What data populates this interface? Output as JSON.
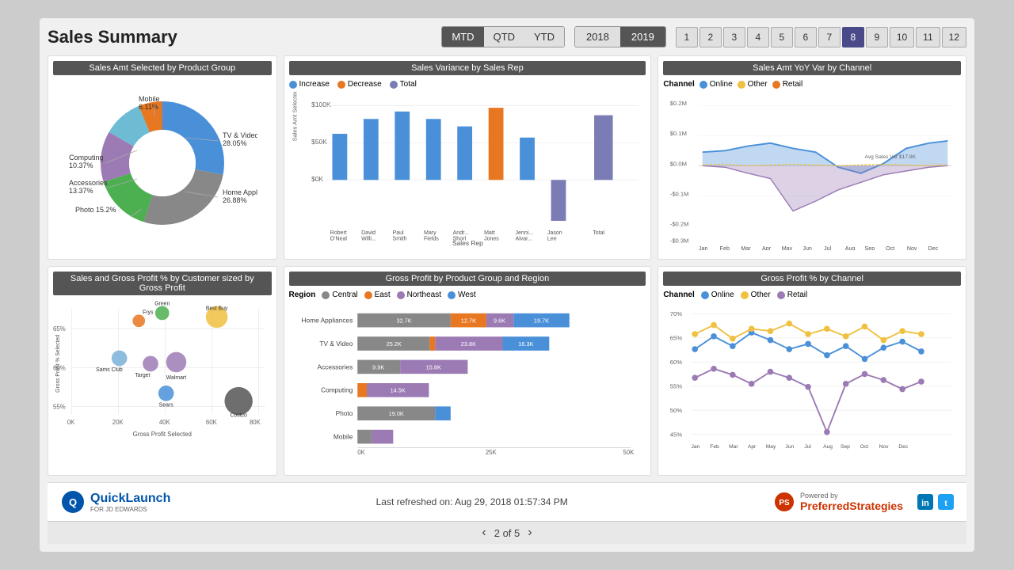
{
  "header": {
    "title": "Sales Summary",
    "period_buttons": [
      "MTD",
      "QTD",
      "YTD"
    ],
    "active_period": "MTD",
    "years": [
      "2018",
      "2019"
    ],
    "active_year": "2019",
    "months": [
      "1",
      "2",
      "3",
      "4",
      "5",
      "6",
      "7",
      "8",
      "9",
      "10",
      "11",
      "12"
    ],
    "active_month": "8"
  },
  "chart1": {
    "title": "Sales Amt Selected by Product Group",
    "segments": [
      {
        "label": "TV & Video",
        "pct": "28.05%",
        "color": "#4a90d9"
      },
      {
        "label": "Home Appliances",
        "pct": "26.88%",
        "color": "#888"
      },
      {
        "label": "Photo",
        "pct": "15.2%",
        "color": "#4caf50"
      },
      {
        "label": "Accessories",
        "pct": "13.37%",
        "color": "#9c7bb5"
      },
      {
        "label": "Computing",
        "pct": "10.37%",
        "color": "#6dbcd4"
      },
      {
        "label": "Mobile",
        "pct": "6.11%",
        "color": "#e87722"
      }
    ]
  },
  "chart2": {
    "title": "Sales Variance by Sales Rep",
    "legend": [
      "Increase",
      "Decrease",
      "Total"
    ],
    "legend_colors": [
      "#4a90d9",
      "#e87722",
      "#7b7bb5"
    ],
    "x_labels": [
      "Robert O'Neal",
      "David Willi...",
      "Paul Smith",
      "Mary Fields",
      "Andr... Short",
      "Matt Jones",
      "Jenni... Alvar...",
      "Jason Lee",
      "Total"
    ],
    "x_axis_label": "Sales Rep",
    "y_axis_label": "Sales Amt Selected Var"
  },
  "chart3": {
    "title": "Sales Amt YoY Var by Channel",
    "legend": [
      "Online",
      "Other",
      "Retail"
    ],
    "legend_colors": [
      "#4a90d9",
      "#f0c040",
      "#e87722"
    ],
    "channel_label": "Channel",
    "y_labels": [
      "$0.2M",
      "$0.1M",
      "$0.0M",
      "-$0.1M",
      "-$0.2M",
      "-$0.3M"
    ],
    "x_labels": [
      "Jan",
      "Feb",
      "Mar",
      "Apr",
      "May",
      "Jun",
      "Jul",
      "Aug",
      "Sep",
      "Oct",
      "Nov",
      "Dec"
    ],
    "avg_label": "Avg Sales Var $17.8K"
  },
  "chart4": {
    "title": "Sales and Gross Profit % by Customer sized by Gross Profit",
    "x_axis": "Gross Profit Selected",
    "y_axis": "Gross Profit % Selected",
    "x_ticks": [
      "0K",
      "20K",
      "40K",
      "60K",
      "80K"
    ],
    "y_ticks": [
      "65%",
      "60%",
      "55%"
    ],
    "bubbles": [
      {
        "label": "Frys",
        "x": 32,
        "y": 72,
        "r": 8,
        "color": "#e87722"
      },
      {
        "label": "Best Buy",
        "x": 62,
        "y": 72,
        "r": 14,
        "color": "#f0c040"
      },
      {
        "label": "Sams Club",
        "x": 24,
        "y": 61,
        "r": 10,
        "color": "#7ab0d8"
      },
      {
        "label": "Target",
        "x": 37,
        "y": 58,
        "r": 10,
        "color": "#9c7bb5"
      },
      {
        "label": "Walmart",
        "x": 49,
        "y": 57,
        "r": 13,
        "color": "#9c7bb5"
      },
      {
        "label": "Sears",
        "x": 44,
        "y": 48,
        "r": 10,
        "color": "#4a90d9"
      },
      {
        "label": "Costco",
        "x": 74,
        "y": 44,
        "r": 18,
        "color": "#555"
      },
      {
        "label": "Green",
        "x": 40,
        "y": 79,
        "r": 9,
        "color": "#4caf50"
      }
    ]
  },
  "chart5": {
    "title": "Gross Profit by Product Group and Region",
    "region_label": "Region",
    "legend": [
      "Central",
      "East",
      "Northeast",
      "West"
    ],
    "legend_colors": [
      "#888",
      "#e87722",
      "#9c7bb5",
      "#4a90d9"
    ],
    "rows": [
      {
        "label": "Home Appliances",
        "segs": [
          {
            "val": "32.7K",
            "pct": 48,
            "color": "#888"
          },
          {
            "val": "12.7K",
            "pct": 18,
            "color": "#e87722"
          },
          {
            "val": "9.6K",
            "pct": 14,
            "color": "#9c7bb5"
          },
          {
            "val": "19.7K",
            "pct": 29,
            "color": "#4a90d9"
          }
        ]
      },
      {
        "label": "TV & Video",
        "segs": [
          {
            "val": "25.2K",
            "pct": 37,
            "color": "#888"
          },
          {
            "val": "",
            "pct": 2,
            "color": "#e87722"
          },
          {
            "val": "23.8K",
            "pct": 35,
            "color": "#9c7bb5"
          },
          {
            "val": "16.3K",
            "pct": 24,
            "color": "#4a90d9"
          }
        ]
      },
      {
        "label": "Accessories",
        "segs": [
          {
            "val": "9.9K",
            "pct": 38,
            "color": "#888"
          },
          {
            "val": "15.8K",
            "pct": 61,
            "color": "#9c7bb5"
          },
          {
            "val": "",
            "pct": 0,
            "color": "#4a90d9"
          },
          {
            "val": "",
            "pct": 0,
            "color": "#e87722"
          }
        ]
      },
      {
        "label": "Computing",
        "segs": [
          {
            "val": "",
            "pct": 6,
            "color": "#e87722"
          },
          {
            "val": "14.5K",
            "pct": 56,
            "color": "#9c7bb5"
          },
          {
            "val": "",
            "pct": 0,
            "color": "#888"
          },
          {
            "val": "",
            "pct": 0,
            "color": "#4a90d9"
          }
        ]
      },
      {
        "label": "Photo",
        "segs": [
          {
            "val": "19.0K",
            "pct": 73,
            "color": "#888"
          },
          {
            "val": "",
            "pct": 10,
            "color": "#4a90d9"
          },
          {
            "val": "",
            "pct": 0,
            "color": "#e87722"
          },
          {
            "val": "",
            "pct": 0,
            "color": "#9c7bb5"
          }
        ]
      },
      {
        "label": "Mobile",
        "segs": [
          {
            "val": "",
            "pct": 12,
            "color": "#888"
          },
          {
            "val": "",
            "pct": 20,
            "color": "#9c7bb5"
          },
          {
            "val": "",
            "pct": 0,
            "color": "#e87722"
          },
          {
            "val": "",
            "pct": 0,
            "color": "#4a90d9"
          }
        ]
      }
    ],
    "x_ticks": [
      "0K",
      "",
      "",
      "",
      "",
      "50K"
    ]
  },
  "chart6": {
    "title": "Gross Profit % by Channel",
    "channel_label": "Channel",
    "legend": [
      "Online",
      "Other",
      "Retail"
    ],
    "legend_colors": [
      "#4a90d9",
      "#f0c040",
      "#9c7bb5"
    ],
    "y_labels": [
      "70%",
      "65%",
      "60%",
      "55%",
      "50%",
      "45%"
    ],
    "x_labels": [
      "Jan",
      "Feb",
      "Mar",
      "Apr",
      "May",
      "Jun",
      "Jul",
      "Aug",
      "Sep",
      "Oct",
      "Nov",
      "Dec"
    ]
  },
  "footer": {
    "refresh_text": "Last refreshed on: Aug 29, 2018 01:57:34 PM",
    "logo_main": "QuickLaunch",
    "logo_sub": "FOR JD EDWARDS",
    "powered_by": "Powered by",
    "brand": "PreferredStrategies"
  },
  "pagination": {
    "current": "2 of 5",
    "prev": "‹",
    "next": "›"
  }
}
